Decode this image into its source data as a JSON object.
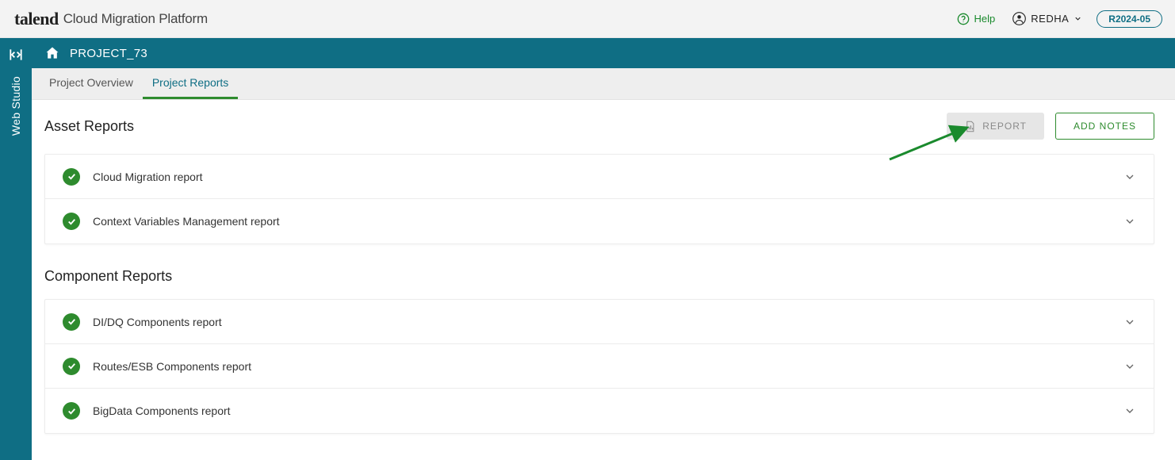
{
  "header": {
    "brand": "talend",
    "product": "Cloud Migration Platform",
    "help": "Help",
    "user": "REDHA",
    "version": "R2024-05"
  },
  "rail": {
    "label": "Web Studio"
  },
  "project": {
    "name": "PROJECT_73"
  },
  "tabs": [
    {
      "label": "Project Overview",
      "active": false
    },
    {
      "label": "Project Reports",
      "active": true
    }
  ],
  "actions": {
    "report": "REPORT",
    "add_notes": "ADD NOTES"
  },
  "sections": {
    "asset": {
      "title": "Asset Reports",
      "items": [
        {
          "label": "Cloud Migration report"
        },
        {
          "label": "Context Variables Management report"
        }
      ]
    },
    "component": {
      "title": "Component Reports",
      "items": [
        {
          "label": "DI/DQ Components report"
        },
        {
          "label": "Routes/ESB Components report"
        },
        {
          "label": "BigData Components report"
        }
      ]
    }
  }
}
